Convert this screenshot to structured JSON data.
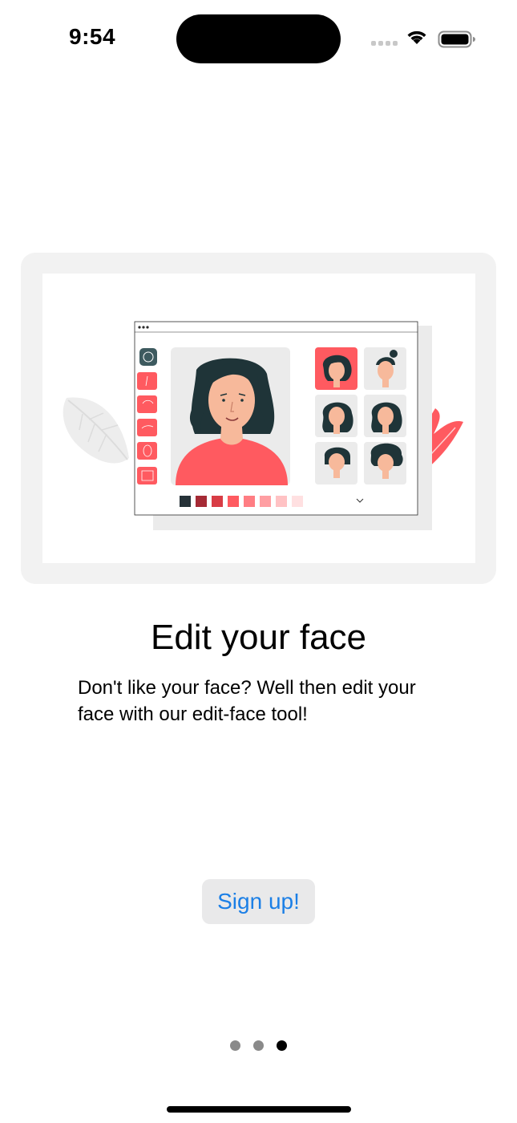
{
  "status_bar": {
    "time": "9:54",
    "icons": [
      "cellular-icon",
      "wifi-icon",
      "battery-icon"
    ]
  },
  "illustration": {
    "icon": "face-editor-illustration",
    "colors": {
      "accent": "#ff5a60",
      "hair": "#1f3438",
      "skin": "#f7b99b",
      "panel": "#ebebeb"
    },
    "swatches": [
      "#263238",
      "#a52a35",
      "#d83c45",
      "#ff5a60",
      "#ff7d83",
      "#ff9ea2",
      "#ffc2c4",
      "#ffe0e1"
    ]
  },
  "onboarding": {
    "title": "Edit your face",
    "description": "Don't like your face? Well then edit your face with our edit-face tool!"
  },
  "actions": {
    "signup_label": "Sign up!"
  },
  "pager": {
    "count": 3,
    "active_index": 2
  },
  "colors": {
    "button_text": "#1b7fe6",
    "button_bg": "#e9e9ea"
  }
}
